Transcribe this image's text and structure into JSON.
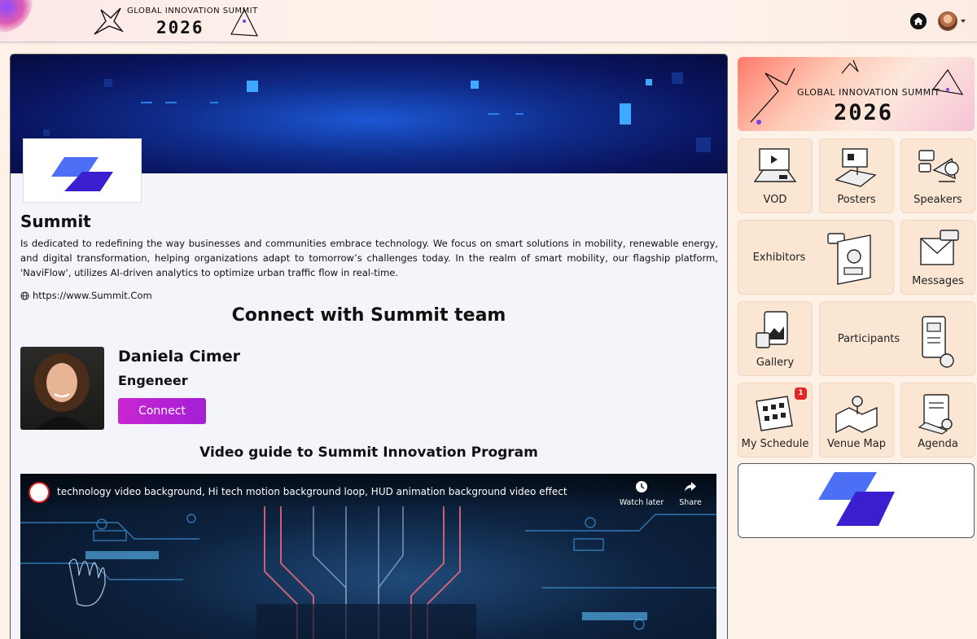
{
  "header": {
    "logo_title": "GLOBAL INNOVATION SUMMIT",
    "logo_year": "2026"
  },
  "company": {
    "name": "Summit",
    "description": "Is dedicated to redefining the way businesses and communities embrace technology. We focus on smart solutions in mobility, renewable energy, and digital transformation, helping organizations adapt to tomorrow’s challenges today. In the realm of smart mobility, our flagship platform, 'NaviFlow', utilizes AI-driven analytics to optimize urban traffic flow in real-time.",
    "website": "https://www.Summit.Com"
  },
  "connect": {
    "title": "Connect with Summit team",
    "person_name": "Daniela Cimer",
    "person_role": "Engeneer",
    "button_label": "Connect"
  },
  "video": {
    "section_title": "Video guide to Summit Innovation Program",
    "title": "technology video background, Hi tech motion background loop, HUD animation background video effect",
    "watch_later": "Watch later",
    "share": "Share"
  },
  "sidebar": {
    "banner_title": "GLOBAL INNOVATION SUMMIT",
    "banner_year": "2026",
    "tiles": [
      {
        "label": "VOD"
      },
      {
        "label": "Posters"
      },
      {
        "label": "Speakers"
      },
      {
        "label": "Exhibitors"
      },
      {
        "label": "Messages"
      },
      {
        "label": "Gallery"
      },
      {
        "label": "Participants"
      },
      {
        "label": "My Schedule",
        "badge": "1"
      },
      {
        "label": "Venue Map"
      },
      {
        "label": "Agenda"
      }
    ]
  },
  "colors": {
    "accent": "#b624d3",
    "brand_blue": "#4a6cf7",
    "brand_indigo": "#3a1fd1",
    "tile_bg": "#fbe6d3",
    "badge": "#e32626"
  },
  "icons": [
    "home-icon",
    "avatar-icon",
    "chevron-down-icon",
    "globe-icon",
    "clock-icon",
    "share-icon"
  ]
}
